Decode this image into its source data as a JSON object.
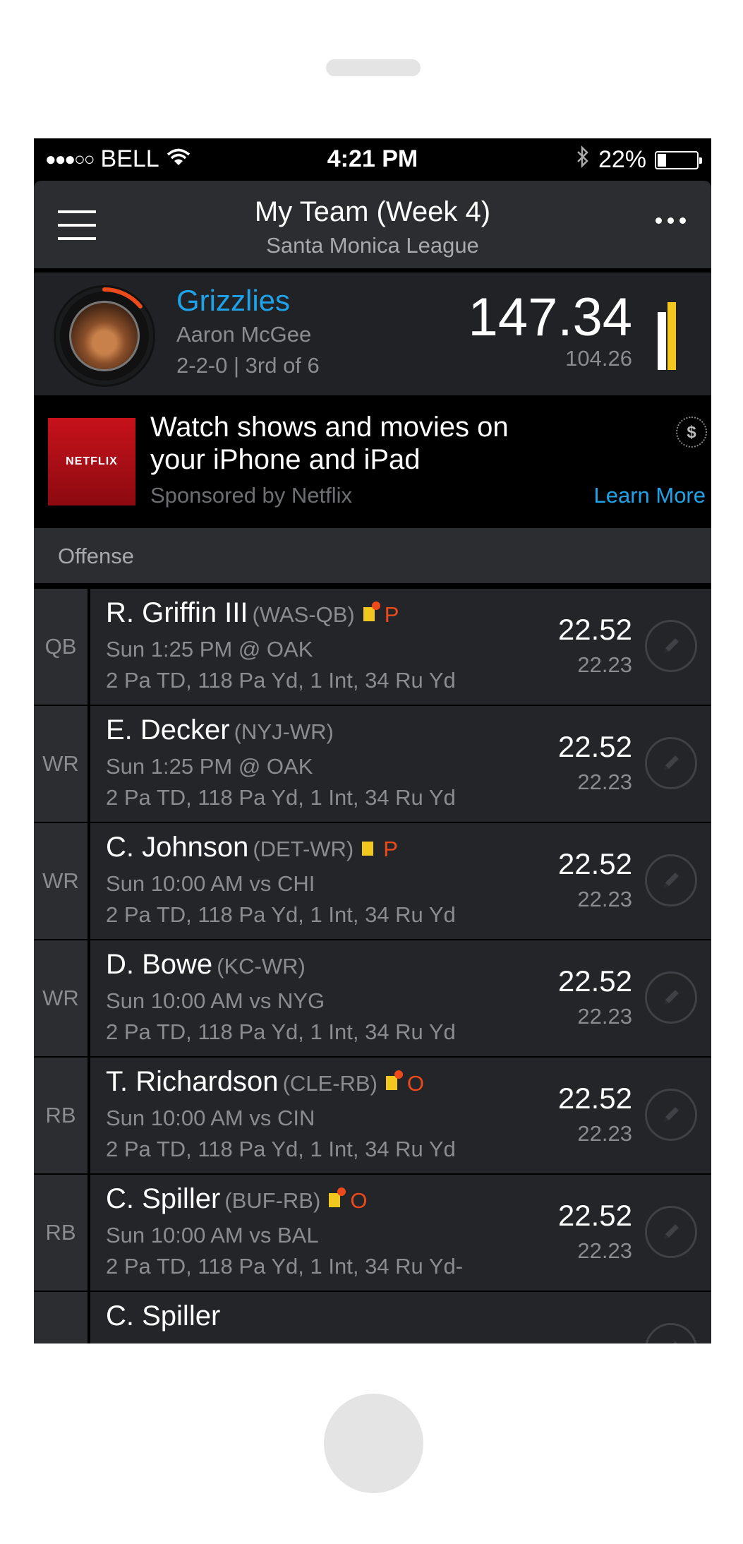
{
  "status_bar": {
    "signal": "●●●○○",
    "carrier": "BELL",
    "time": "4:21 PM",
    "battery_text": "22%",
    "battery_level": 0.22
  },
  "nav": {
    "title": "My Team (Week 4)",
    "subtitle": "Santa Monica League"
  },
  "team": {
    "name": "Grizzlies",
    "owner": "Aaron McGee",
    "record": "2-2-0 | 3rd of 6",
    "score": "147.34",
    "projected": "104.26",
    "progress": 0.14,
    "bar_white": 0.85,
    "bar_yellow": 1.0,
    "accent_color": "#1ea3e9",
    "progress_color": "#ec4a1a",
    "bar_color": "#f2c81f"
  },
  "ad": {
    "logo_text": "NETFLIX",
    "title": "Watch shows and movies on your iPhone and iPad",
    "sponsor": "Sponsored by Netflix",
    "cta": "Learn More",
    "icon_text": "$"
  },
  "section": {
    "label": "Offense"
  },
  "players": [
    {
      "pos": "QB",
      "name": "R. Griffin III",
      "team": "(WAS-QB)",
      "game": "Sun 1:25 PM @ OAK",
      "stats": "2 Pa TD, 118 Pa Yd, 1 Int, 34 Ru Yd",
      "points": "22.52",
      "projected": "22.23",
      "status": "P"
    },
    {
      "pos": "WR",
      "name": "E. Decker",
      "team": "(NYJ-WR)",
      "game": "Sun 1:25 PM @ OAK",
      "stats": "2 Pa TD, 118 Pa Yd, 1 Int, 34 Ru Yd",
      "points": "22.52",
      "projected": "22.23",
      "status": ""
    },
    {
      "pos": "WR",
      "name": "C. Johnson",
      "team": "(DET-WR)",
      "game": "Sun 10:00 AM vs CHI",
      "stats": "2 Pa TD, 118 Pa Yd, 1 Int, 34 Ru Yd",
      "points": "22.52",
      "projected": "22.23",
      "status": "P"
    },
    {
      "pos": "WR",
      "name": "D. Bowe",
      "team": "(KC-WR)",
      "game": "Sun 10:00 AM vs NYG",
      "stats": "2 Pa TD, 118 Pa Yd, 1 Int, 34 Ru Yd",
      "points": "22.52",
      "projected": "22.23",
      "status": ""
    },
    {
      "pos": "RB",
      "name": "T. Richardson",
      "team": "(CLE-RB)",
      "game": "Sun 10:00 AM vs CIN",
      "stats": "2 Pa TD, 118 Pa Yd, 1 Int, 34 Ru Yd",
      "points": "22.52",
      "projected": "22.23",
      "status": "O"
    },
    {
      "pos": "RB",
      "name": "C. Spiller",
      "team": "(BUF-RB)",
      "game": "Sun 10:00 AM vs BAL",
      "stats": "2 Pa TD, 118 Pa Yd, 1 Int, 34 Ru Yd-",
      "points": "22.52",
      "projected": "22.23",
      "status": "O"
    },
    {
      "pos": "",
      "name": "C. Spiller",
      "team": "",
      "game": "",
      "stats": "",
      "points": "",
      "projected": "",
      "status": ""
    }
  ]
}
